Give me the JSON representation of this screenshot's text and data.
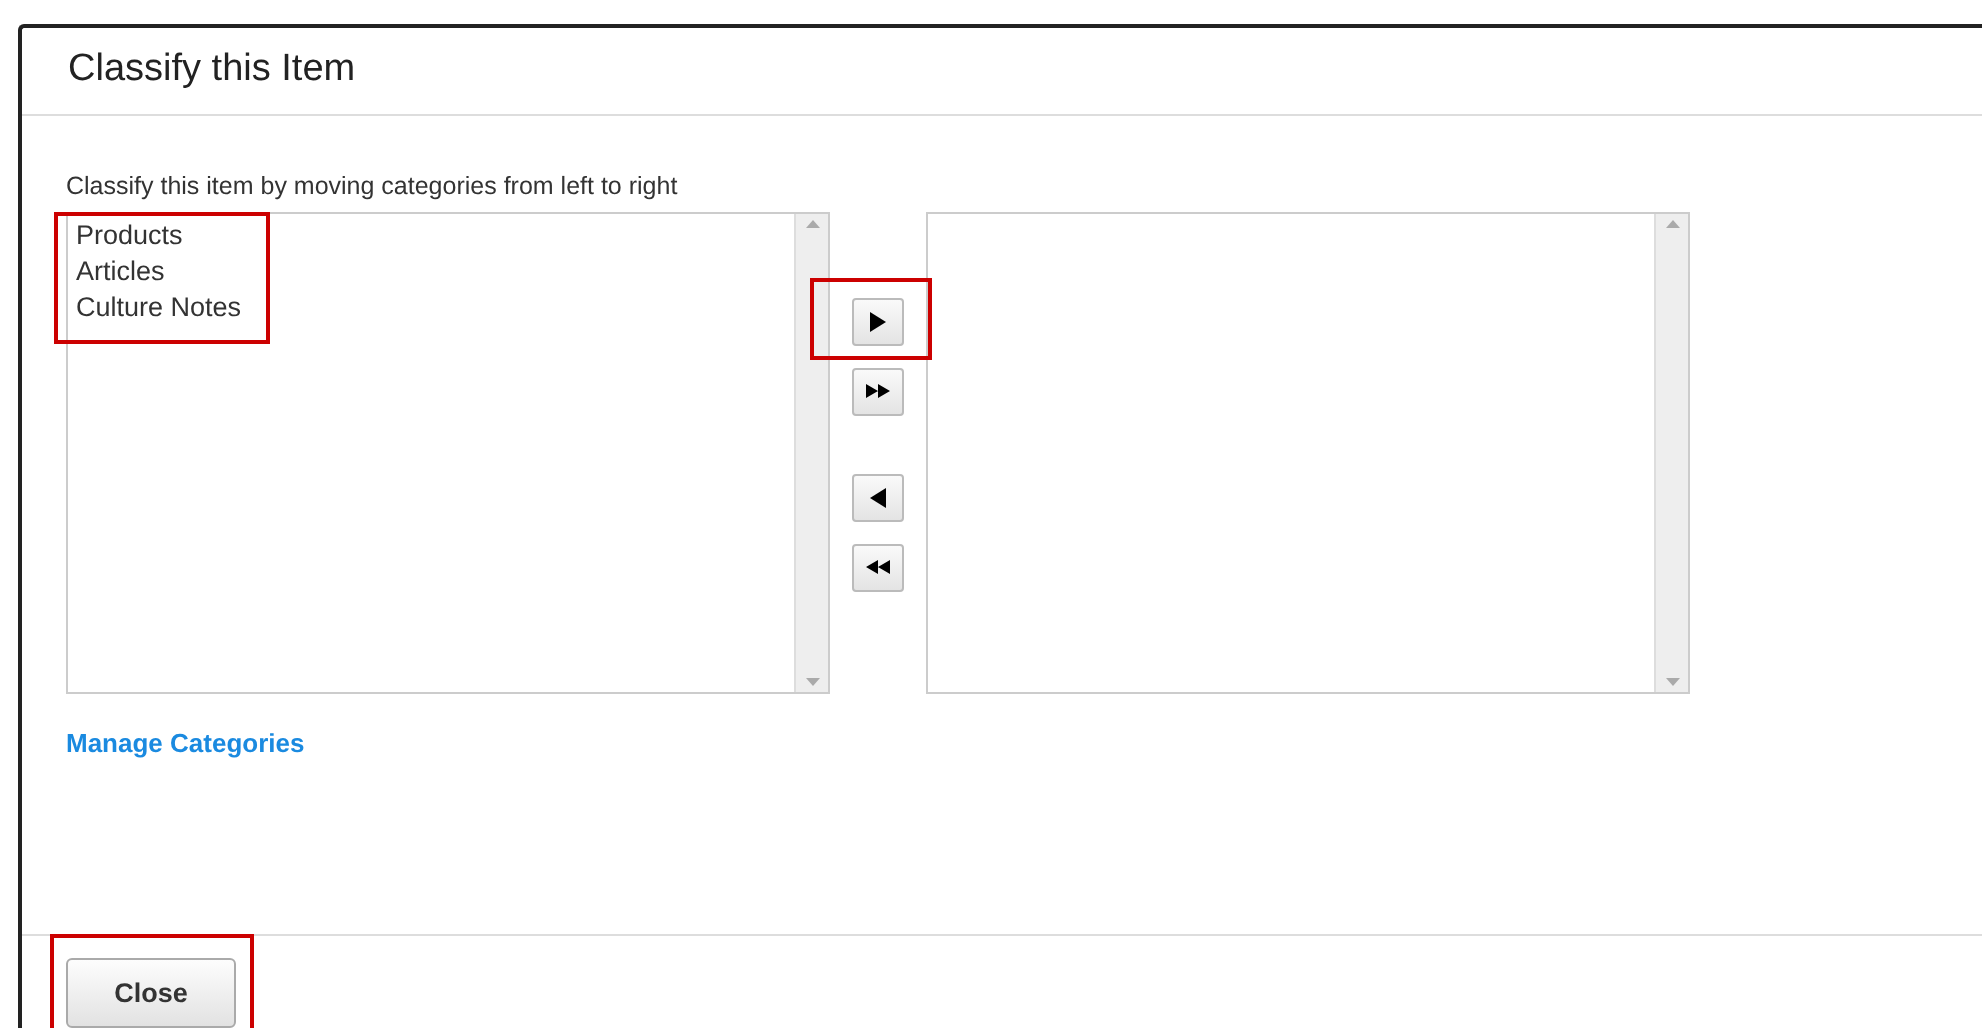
{
  "dialog": {
    "title": "Classify this Item"
  },
  "instruction": "Classify this item by moving categories from left to right",
  "available_list": {
    "highlighted": true,
    "items": [
      "Products",
      "Articles",
      "Culture Notes"
    ]
  },
  "move_buttons": [
    {
      "kind": "right",
      "highlighted": true
    },
    {
      "kind": "all_right"
    },
    {
      "kind": "left"
    },
    {
      "kind": "all_left"
    }
  ],
  "link": "Manage Categories",
  "close_button": {
    "label": "Close",
    "highlighted": true
  }
}
